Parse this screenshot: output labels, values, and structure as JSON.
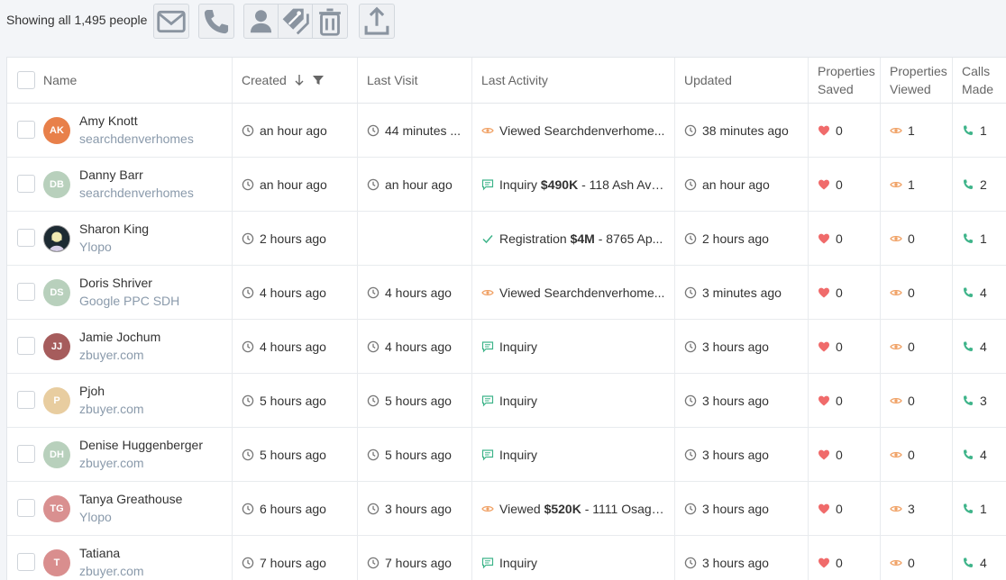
{
  "toolbar": {
    "showing_text": "Showing all 1,495 people",
    "buttons": [
      "email-icon",
      "phone-icon",
      "person-icon",
      "tag-icon",
      "trash-icon",
      "export-icon"
    ]
  },
  "columns": {
    "name": "Name",
    "created": "Created",
    "last_visit": "Last Visit",
    "last_activity": "Last Activity",
    "updated": "Updated",
    "properties_saved_1": "Properties",
    "properties_saved_2": "Saved",
    "properties_viewed_1": "Properties",
    "properties_viewed_2": "Viewed",
    "calls_made_1": "Calls",
    "calls_made_2": "Made"
  },
  "colors": {
    "heart": "#f06b6b",
    "eye": "#f0a063",
    "phone": "#3fb48a",
    "inquiry": "#3fb48a"
  },
  "rows": [
    {
      "initials": "AK",
      "avatar_color": "#e8804a",
      "name": "Amy Knott",
      "source": "searchdenverhomes",
      "created": "an hour ago",
      "last_visit": "44 minutes ...",
      "activity_type": "viewed",
      "activity_label": "Viewed Searchdenverhome...",
      "activity_price": "",
      "activity_rest": "",
      "updated": "38 minutes ago",
      "saved": "0",
      "viewed": "1",
      "calls": "1"
    },
    {
      "initials": "DB",
      "avatar_color": "#b8d0bc",
      "name": "Danny Barr",
      "source": "searchdenverhomes",
      "created": "an hour ago",
      "last_visit": "an hour ago",
      "activity_type": "inquiry",
      "activity_label": "Inquiry",
      "activity_price": "$490K",
      "activity_rest": "- 118 Ash Ave...",
      "updated": "an hour ago",
      "saved": "0",
      "viewed": "1",
      "calls": "2"
    },
    {
      "initials": "",
      "avatar_color": "#2b2b3a",
      "name": "Sharon King",
      "source": "Ylopo",
      "created": "2 hours ago",
      "last_visit": "",
      "activity_type": "registration",
      "activity_label": "Registration",
      "activity_price": "$4M",
      "activity_rest": "- 8765 Ap...",
      "updated": "2 hours ago",
      "saved": "0",
      "viewed": "0",
      "calls": "1"
    },
    {
      "initials": "DS",
      "avatar_color": "#b8d0bc",
      "name": "Doris Shriver",
      "source": "Google PPC SDH",
      "created": "4 hours ago",
      "last_visit": "4 hours ago",
      "activity_type": "viewed",
      "activity_label": "Viewed Searchdenverhome...",
      "activity_price": "",
      "activity_rest": "",
      "updated": "3 minutes ago",
      "saved": "0",
      "viewed": "0",
      "calls": "4"
    },
    {
      "initials": "JJ",
      "avatar_color": "#a65c5c",
      "name": "Jamie Jochum",
      "source": "zbuyer.com",
      "created": "4 hours ago",
      "last_visit": "4 hours ago",
      "activity_type": "inquiry",
      "activity_label": "Inquiry",
      "activity_price": "",
      "activity_rest": "",
      "updated": "3 hours ago",
      "saved": "0",
      "viewed": "0",
      "calls": "4"
    },
    {
      "initials": "P",
      "avatar_color": "#e8cda0",
      "name": "Pjoh",
      "source": "zbuyer.com",
      "created": "5 hours ago",
      "last_visit": "5 hours ago",
      "activity_type": "inquiry",
      "activity_label": "Inquiry",
      "activity_price": "",
      "activity_rest": "",
      "updated": "3 hours ago",
      "saved": "0",
      "viewed": "0",
      "calls": "3"
    },
    {
      "initials": "DH",
      "avatar_color": "#b8d0bc",
      "name": "Denise Huggenberger",
      "source": "zbuyer.com",
      "created": "5 hours ago",
      "last_visit": "5 hours ago",
      "activity_type": "inquiry",
      "activity_label": "Inquiry",
      "activity_price": "",
      "activity_rest": "",
      "updated": "3 hours ago",
      "saved": "0",
      "viewed": "0",
      "calls": "4"
    },
    {
      "initials": "TG",
      "avatar_color": "#d99090",
      "name": "Tanya Greathouse",
      "source": "Ylopo",
      "created": "6 hours ago",
      "last_visit": "3 hours ago",
      "activity_type": "viewed",
      "activity_label": "Viewed",
      "activity_price": "$520K",
      "activity_rest": "- 1111 Osage ...",
      "updated": "3 hours ago",
      "saved": "0",
      "viewed": "3",
      "calls": "1"
    },
    {
      "initials": "T",
      "avatar_color": "#d98e8e",
      "name": "Tatiana",
      "source": "zbuyer.com",
      "created": "7 hours ago",
      "last_visit": "7 hours ago",
      "activity_type": "inquiry",
      "activity_label": "Inquiry",
      "activity_price": "",
      "activity_rest": "",
      "updated": "3 hours ago",
      "saved": "0",
      "viewed": "0",
      "calls": "4"
    }
  ]
}
